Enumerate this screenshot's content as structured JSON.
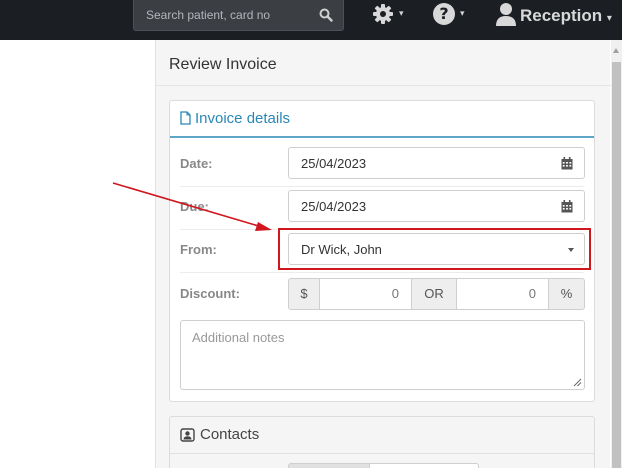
{
  "topbar": {
    "search_placeholder": "Search patient, card no",
    "settings_icon": "gear-icon",
    "help_icon": "question-circle-icon",
    "help_glyph": "?",
    "user_icon": "user-icon",
    "user_label": "Reception",
    "caret": "▾"
  },
  "panel": {
    "title": "Review Invoice"
  },
  "invoice_details": {
    "heading": "Invoice details",
    "heading_icon": "document-icon",
    "date_label": "Date:",
    "date_value": "25/04/2023",
    "due_label": "Due:",
    "due_value": "25/04/2023",
    "from_label": "From:",
    "from_value": "Dr Wick, John",
    "discount_label": "Discount:",
    "currency_symbol": "$",
    "discount_amount": "0",
    "or_label": "OR",
    "discount_percent": "0",
    "percent_symbol": "%",
    "notes_placeholder": "Additional notes"
  },
  "contacts": {
    "heading": "Contacts",
    "heading_icon": "contacts-icon"
  },
  "colors": {
    "topbar": "#1b1f24",
    "accent_blue": "#2a87b5",
    "annotation_red": "#d0161e"
  }
}
